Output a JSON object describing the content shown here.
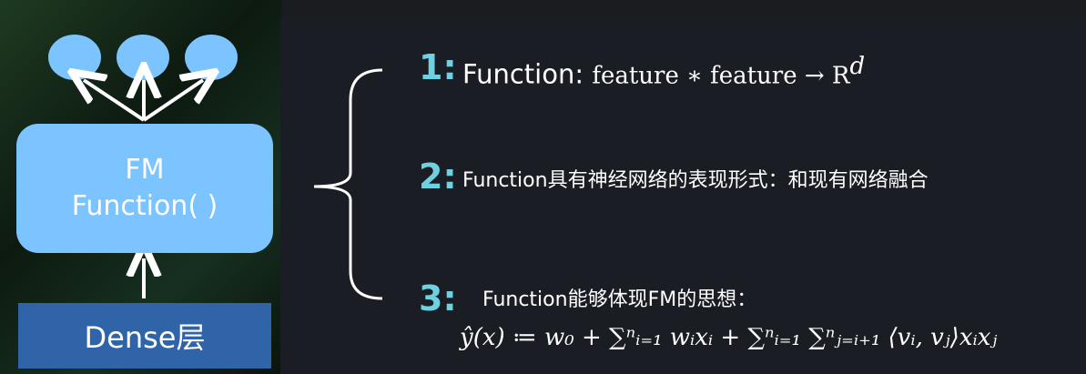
{
  "left_diagram": {
    "fm_box": {
      "line1": "FM",
      "line2": "Function( )"
    },
    "dense_label": "Dense层",
    "output_nodes": [
      "output-node-1",
      "output-node-2",
      "output-node-3"
    ]
  },
  "points": {
    "p1": {
      "number": "1:",
      "label": "Function: ",
      "formula": "feature ∗ feature → R",
      "superscript": "d"
    },
    "p2": {
      "number": "2:",
      "text": "Function具有神经网络的表现形式：和现有网络融合"
    },
    "p3": {
      "number": "3:",
      "text": "Function能够体现FM的思想：",
      "formula": "ŷ(x) ≔ w₀ + ∑ⁿᵢ₌₁ wᵢxᵢ + ∑ⁿᵢ₌₁ ∑ⁿⱼ₌ᵢ₊₁ ⟨vᵢ, vⱼ⟩xᵢxⱼ"
    }
  },
  "colors": {
    "node_fill": "#7cc4ff",
    "dense_fill": "#2f64a8",
    "number_color": "#6fd0e0"
  }
}
